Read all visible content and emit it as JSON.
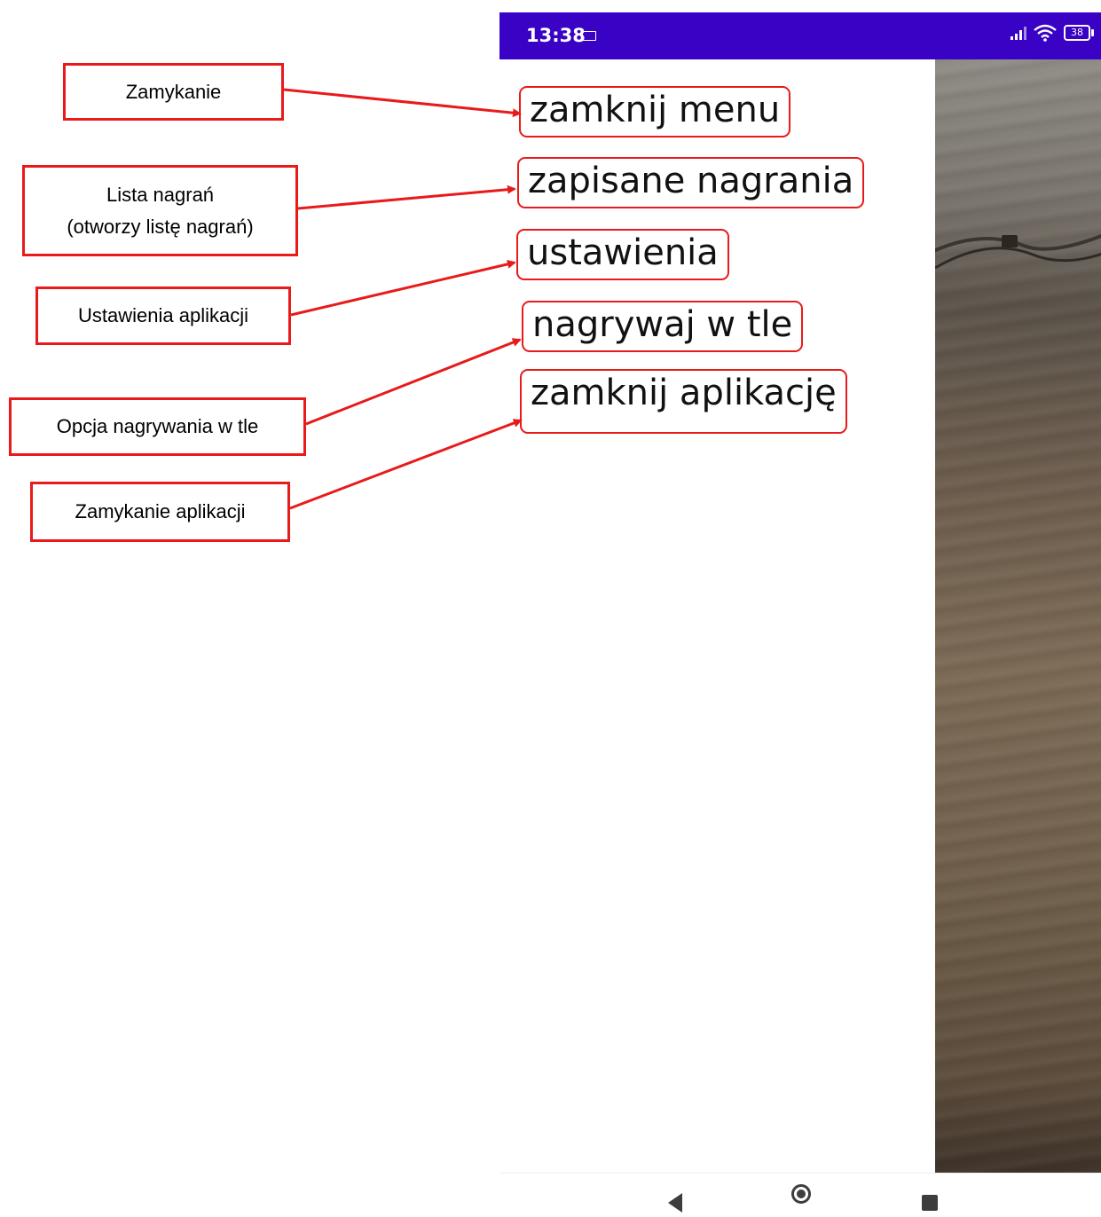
{
  "status_bar": {
    "time": "13:38",
    "battery": "38"
  },
  "menu": {
    "items": [
      {
        "label": "zamknij menu"
      },
      {
        "label": "zapisane nagrania"
      },
      {
        "label": "ustawienia"
      },
      {
        "label": "nagrywaj w tle"
      },
      {
        "label": "zamknij aplikację"
      }
    ]
  },
  "annotations": {
    "close": "Zamykanie",
    "recordings_line1": "Lista nagrań",
    "recordings_line2": "(otworzy listę nagrań)",
    "settings": "Ustawienia aplikacji",
    "background": "Opcja nagrywania w tle",
    "close_app": "Zamykanie aplikacji"
  },
  "colors": {
    "status_bar": "#3a02c4",
    "annotation": "#e81a1a"
  },
  "nav_icons": [
    "back-icon",
    "home-icon",
    "recents-icon"
  ]
}
